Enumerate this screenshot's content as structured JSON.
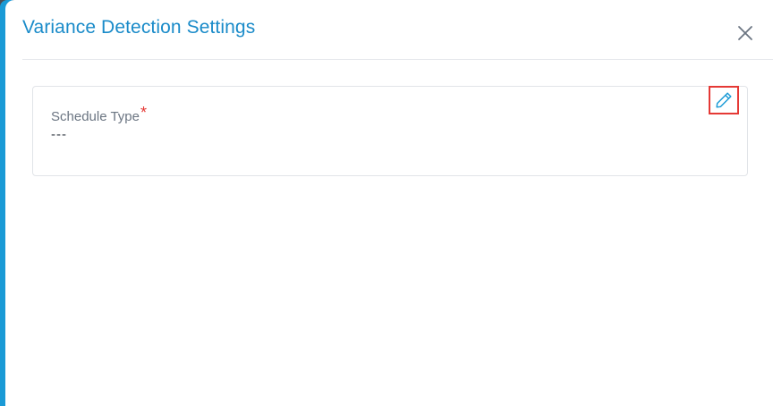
{
  "modal": {
    "title": "Variance Detection Settings",
    "close_icon": "close-icon"
  },
  "schedule": {
    "label": "Schedule Type",
    "required_marker": "*",
    "value": "---",
    "edit_icon": "pencil-icon"
  },
  "colors": {
    "accent": "#1a9ad6",
    "title": "#1a8bc9",
    "required": "#e53935",
    "highlight": "#e53935"
  }
}
